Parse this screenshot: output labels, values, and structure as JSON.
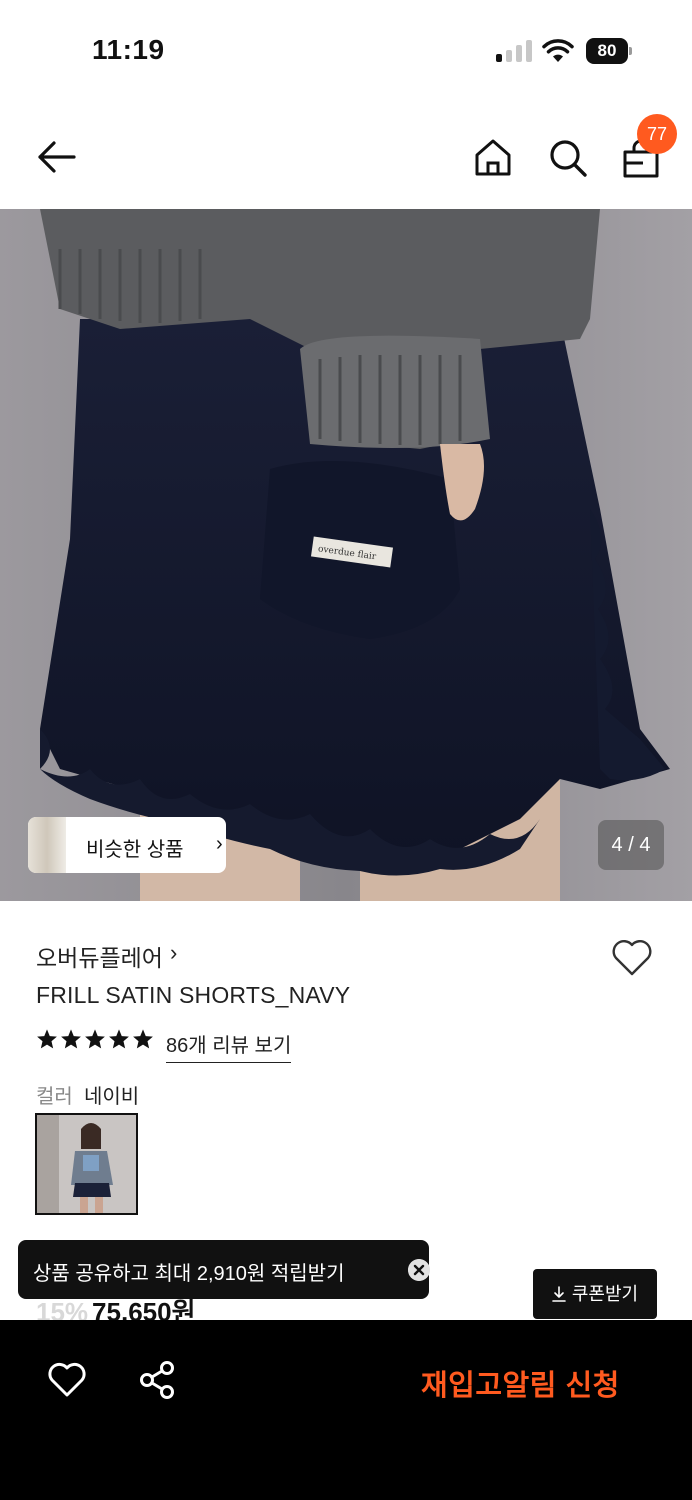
{
  "status_bar": {
    "time": "11:19",
    "battery": "80",
    "icons": [
      "cellular-signal-icon",
      "wifi-icon",
      "battery-icon"
    ]
  },
  "nav": {
    "icons": [
      "back-arrow-icon",
      "home-icon",
      "search-icon",
      "shopping-bag-icon"
    ],
    "cart_count": "77"
  },
  "hero": {
    "similar_products_label": "비슷한 상품",
    "page_indicator": "4 / 4",
    "product_tag_text": "overdue flair"
  },
  "product": {
    "brand": "오버듀플레어",
    "name": "FRILL SATIN SHORTS_NAVY",
    "rating_stars": 5,
    "review_link": "86개 리뷰 보기",
    "color_label": "컬러",
    "color_value": "네이비"
  },
  "share_toast": {
    "text": "상품 공유하고 최대 2,910원 적립받기"
  },
  "coupon_button": "쿠폰받기",
  "price": {
    "discount": "15%",
    "amount": "75,650원"
  },
  "bottom_bar": {
    "restock_label": "재입고알림 신청"
  },
  "colors": {
    "accent": "#ff5a1f",
    "dark": "#111111",
    "bottom_bar": "#000000"
  }
}
